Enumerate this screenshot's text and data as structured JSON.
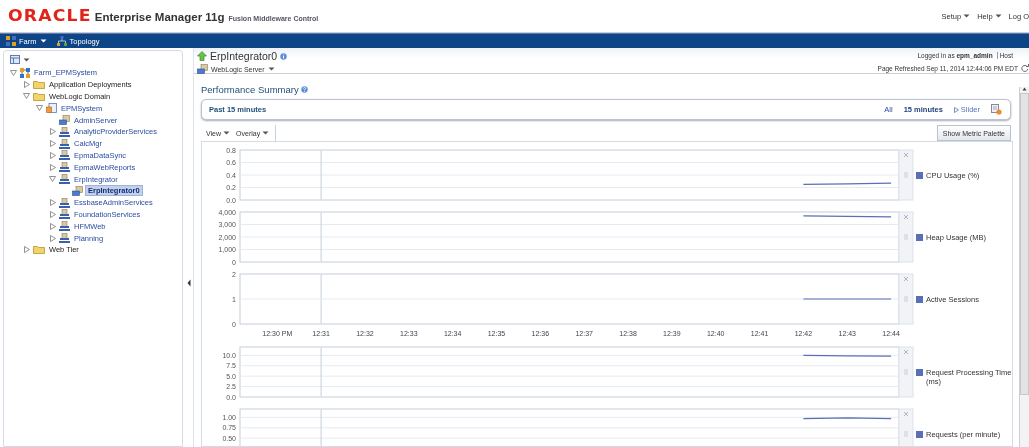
{
  "header": {
    "brand": "ORACLE",
    "product": "Enterprise Manager 11g",
    "subtitle": "Fusion Middleware Control",
    "menus": [
      {
        "label": "Setup",
        "dropdown": true
      },
      {
        "label": "Help",
        "dropdown": true
      },
      {
        "label": "Log O",
        "dropdown": false
      }
    ]
  },
  "navbar": {
    "items": [
      {
        "label": "Farm",
        "kind": "farm",
        "dropdown": true
      },
      {
        "label": "Topology",
        "kind": "topology",
        "dropdown": false
      }
    ]
  },
  "tree": [
    {
      "label": "Farm_EPMSystem",
      "kind": "farm",
      "expanded": true,
      "selected": false,
      "children": [
        {
          "label": "Application Deployments",
          "kind": "folder",
          "expanded": false,
          "selected": false
        },
        {
          "label": "WebLogic Domain",
          "kind": "folder",
          "expanded": true,
          "selected": false,
          "children": [
            {
              "label": "EPMSystem",
              "kind": "domain",
              "expanded": true,
              "selected": false,
              "children": [
                {
                  "label": "AdminServer",
                  "kind": "server",
                  "selected": false
                },
                {
                  "label": "AnalyticProviderServices",
                  "kind": "cluster",
                  "expanded": false,
                  "selected": false
                },
                {
                  "label": "CalcMgr",
                  "kind": "cluster",
                  "expanded": false,
                  "selected": false
                },
                {
                  "label": "EpmaDataSync",
                  "kind": "cluster",
                  "expanded": false,
                  "selected": false
                },
                {
                  "label": "EpmaWebReports",
                  "kind": "cluster",
                  "expanded": false,
                  "selected": false
                },
                {
                  "label": "ErpIntegrator",
                  "kind": "cluster",
                  "expanded": true,
                  "selected": false,
                  "children": [
                    {
                      "label": "ErpIntegrator0",
                      "kind": "server",
                      "selected": true
                    }
                  ]
                },
                {
                  "label": "EssbaseAdminServices",
                  "kind": "cluster",
                  "expanded": false,
                  "selected": false
                },
                {
                  "label": "FoundationServices",
                  "kind": "cluster",
                  "expanded": false,
                  "selected": false
                },
                {
                  "label": "HFMWeb",
                  "kind": "cluster",
                  "expanded": false,
                  "selected": false
                },
                {
                  "label": "Planning",
                  "kind": "cluster",
                  "expanded": false,
                  "selected": false
                }
              ]
            }
          ]
        },
        {
          "label": "Web Tier",
          "kind": "folder",
          "expanded": false,
          "selected": false
        }
      ]
    }
  ],
  "target": {
    "name": "ErpIntegrator0",
    "type_menu": "WebLogic Server",
    "logged_in": "Logged in as **epm_admin**",
    "host_label": "Host",
    "refreshed": "Page Refreshed Sep 11, 2014 12:44:06 PM EDT"
  },
  "performance": {
    "title": "Performance Summary",
    "period": "Past 15 minutes",
    "ranges": [
      {
        "label": "All",
        "selected": false
      },
      {
        "label": "15 minutes",
        "selected": true
      }
    ],
    "slider": "Slider",
    "view_menus": [
      "View",
      "Overlay"
    ],
    "palette_button": "Show Metric Palette",
    "charts": [
      {
        "chart_data": {
          "type": "line",
          "grid": true,
          "ylim": [
            0,
            0.8
          ],
          "yticks": [
            {
              "value": 0,
              "label": "0.0"
            },
            {
              "value": 0.2,
              "label": "0.2"
            },
            {
              "value": 0.4,
              "label": "0.4"
            },
            {
              "value": 0.6,
              "label": "0.6"
            },
            {
              "value": 0.8,
              "label": "0.8"
            }
          ],
          "categories": [
            null,
            null,
            null,
            null,
            null,
            null,
            null,
            null,
            null,
            null,
            null,
            null,
            null,
            null,
            null
          ],
          "series": [
            {
              "name": "CPU Usage (%)",
              "color": "#5b6fb8",
              "values": [
                null,
                null,
                null,
                null,
                null,
                null,
                null,
                null,
                null,
                null,
                null,
                null,
                0.25,
                0.26,
                0.27
              ]
            }
          ]
        }
      },
      {
        "chart_data": {
          "type": "line",
          "grid": true,
          "ylim": [
            0,
            4000
          ],
          "yticks": [
            {
              "value": 0,
              "label": "0"
            },
            {
              "value": 1000,
              "label": "1,000"
            },
            {
              "value": 2000,
              "label": "2,000"
            },
            {
              "value": 3000,
              "label": "3,000"
            },
            {
              "value": 4000,
              "label": "4,000"
            }
          ],
          "categories": [
            null,
            null,
            null,
            null,
            null,
            null,
            null,
            null,
            null,
            null,
            null,
            null,
            null,
            null,
            null
          ],
          "series": [
            {
              "name": "Heap Usage (MB)",
              "color": "#5b6fb8",
              "values": [
                null,
                null,
                null,
                null,
                null,
                null,
                null,
                null,
                null,
                null,
                null,
                null,
                3700,
                3660,
                3620
              ]
            }
          ]
        }
      },
      {
        "chart_data": {
          "type": "line",
          "ref_lines": [
            {
              "axis": "x",
              "value": "12:31"
            },
            {
              "axis": "y",
              "value": 1
            }
          ],
          "ylim": [
            0,
            2
          ],
          "yticks": [
            {
              "value": 0,
              "label": "0"
            },
            {
              "value": 1,
              "label": "1"
            },
            {
              "value": 2,
              "label": "2"
            }
          ],
          "categories": [
            "12:30 PM",
            "12:31",
            "12:32",
            "12:33",
            "12:34",
            "12:35",
            "12:36",
            "12:37",
            "12:38",
            "12:39",
            "12:40",
            "12:41",
            "12:42",
            "12:43",
            "12:44"
          ],
          "series": [
            {
              "name": "Active Sessions",
              "color": "#5b6fb8",
              "values": [
                null,
                null,
                null,
                null,
                null,
                null,
                null,
                null,
                null,
                null,
                null,
                null,
                1,
                1,
                1
              ]
            }
          ]
        }
      },
      {
        "chart_data": {
          "type": "line",
          "grid": true,
          "ylim": [
            0,
            12
          ],
          "yticks": [
            {
              "value": 0,
              "label": "0.0"
            },
            {
              "value": 2.5,
              "label": "2.5"
            },
            {
              "value": 5,
              "label": "5.0"
            },
            {
              "value": 7.5,
              "label": "7.5"
            },
            {
              "value": 10,
              "label": "10.0"
            }
          ],
          "categories": [
            null,
            null,
            null,
            null,
            null,
            null,
            null,
            null,
            null,
            null,
            null,
            null,
            null,
            null,
            null
          ],
          "series": [
            {
              "name": "Request Processing Time (ms)",
              "color": "#5b6fb8",
              "values": [
                null,
                null,
                null,
                null,
                null,
                null,
                null,
                null,
                null,
                null,
                null,
                null,
                10.0,
                9.9,
                9.8
              ]
            }
          ]
        }
      },
      {
        "chart_data": {
          "type": "line",
          "grid": true,
          "ylim": [
            0,
            1.2
          ],
          "yticks": [
            {
              "value": 0.5,
              "label": "0.50"
            },
            {
              "value": 0.75,
              "label": "0.75"
            },
            {
              "value": 1,
              "label": "1.00"
            }
          ],
          "categories": [
            null,
            null,
            null,
            null,
            null,
            null,
            null,
            null,
            null,
            null,
            null,
            null,
            null,
            null,
            null
          ],
          "series": [
            {
              "name": "Requests (per minute)",
              "color": "#5b6fb8",
              "values": [
                null,
                null,
                null,
                null,
                null,
                null,
                null,
                null,
                null,
                null,
                null,
                null,
                0.97,
                0.99,
                0.97
              ]
            }
          ]
        }
      }
    ]
  }
}
